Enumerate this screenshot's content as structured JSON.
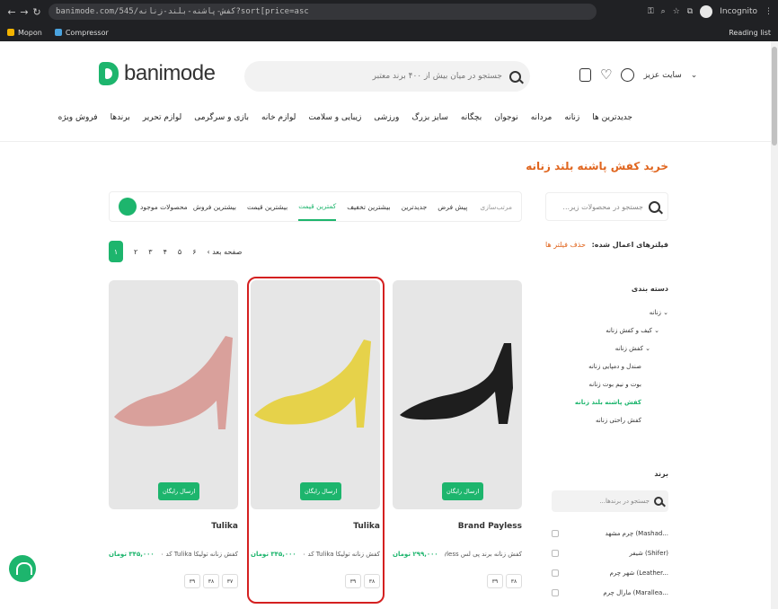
{
  "browser": {
    "url": "banimode.com/545/کفش-پاشنه-بلند-زنانه?sort[price=asc",
    "incognito": "Incognito",
    "bookmarks": [
      "Mopon",
      "Compressor"
    ],
    "reading_list": "Reading list"
  },
  "header": {
    "logo_text": "banimode",
    "search_placeholder": "جستجو در میان بیش از ۴۰۰ برند معتبر",
    "site_name": "سایت عزیز"
  },
  "menu": [
    "جدیدترین ها",
    "زنانه",
    "مردانه",
    "نوجوان",
    "بچگانه",
    "سایز بزرگ",
    "ورزشی",
    "زیبایی و سلامت",
    "لوازم خانه",
    "بازی و سرگرمی",
    "لوازم تحریر",
    "برندها",
    "فروش ویژه"
  ],
  "page_title": "خرید کفش پاشنه بلند زنانه",
  "sidebar": {
    "search_placeholder": "جستجو در محصولات زیر...",
    "applied_filters": "فیلترهای اعمال شده:",
    "clear_filters": "حذف فیلتر ها",
    "category_title": "دسته بندی",
    "categories": [
      "زنانه",
      "کیف و کفش زنانه",
      "کفش زنانه",
      "صندل و دمپایی زنانه",
      "بوت و نیم بوت زنانه",
      "کفش پاشنه بلند زنانه",
      "کفش راحتی زنانه"
    ],
    "brand_title": "برند",
    "brand_search": "جستجو در برندها...",
    "brands": [
      "چرم مشهد (Mashad...",
      "شیفر (Shifer)",
      "شهر چرم (Leather...",
      "مارال چرم (Marallea..."
    ]
  },
  "sort": {
    "label": "مرتب‌سازی",
    "options": [
      "پیش فرض",
      "جدیدترین",
      "بیشترین تخفیف",
      "کمترین قیمت",
      "بیشترین قیمت",
      "بیشترین فروش"
    ],
    "active": "کمترین قیمت",
    "available": "محصولات موجود"
  },
  "pager": {
    "pages": [
      "۱",
      "۲",
      "۳",
      "۴",
      "۵",
      "۶"
    ],
    "next": "صفحه بعد"
  },
  "ship_label": "ارسال رایگان",
  "products": [
    {
      "brand": "Brand Payless",
      "name": "کفش زنانه برند پی لس ayless...",
      "price": "۲۹۹,۰۰۰ تومان",
      "sizes": [
        "۳۸",
        "۳۹"
      ]
    },
    {
      "brand": "Tulika",
      "name": "کفش زنانه تولیکا Tulika کد ۱۰...",
      "price": "۳۴۵,۰۰۰ تومان",
      "sizes": [
        "۳۸",
        "۳۹"
      ]
    },
    {
      "brand": "Tulika",
      "name": "کفش زنانه تولیکا Tulika کد ۱۰...",
      "price": "۳۴۵,۰۰۰ تومان",
      "sizes": [
        "۳۷",
        "۳۸",
        "۳۹"
      ]
    }
  ],
  "colors": {
    "accent": "#1db56d",
    "orange": "#e0651e",
    "highlight": "#d42020"
  }
}
